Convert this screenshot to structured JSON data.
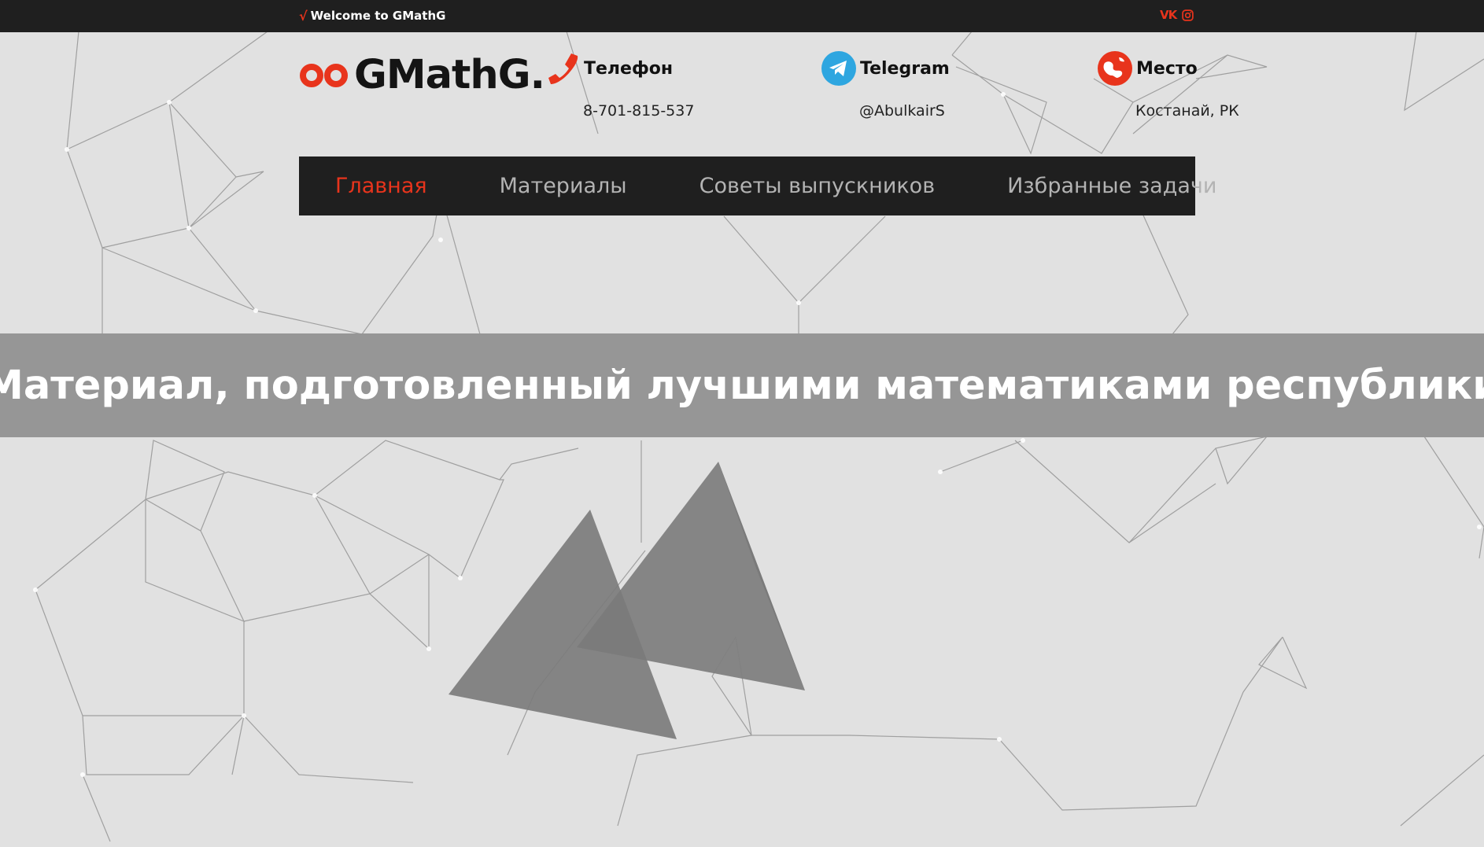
{
  "topbar": {
    "welcome_text": "Welcome to GMathG",
    "welcome_icon": "sqrt-icon",
    "social": [
      {
        "name": "vk",
        "label": "VK"
      },
      {
        "name": "instagram",
        "label": ""
      }
    ]
  },
  "header": {
    "logo_text": "GMathG.",
    "contacts": [
      {
        "title": "Телефон",
        "value": "8-701-815-537",
        "icon": "phone-icon"
      },
      {
        "title": "Telegram",
        "value": "@AbulkairS",
        "icon": "telegram-icon"
      },
      {
        "title": "Место",
        "value": "Костанай, РК",
        "icon": "globe-icon"
      }
    ]
  },
  "nav": {
    "items": [
      {
        "label": "Главная"
      },
      {
        "label": "Материалы"
      },
      {
        "label": "Советы выпускников"
      },
      {
        "label": "Избранные задачи"
      }
    ]
  },
  "banner": {
    "text": "Материал, подготовленный лучшими математиками республики"
  },
  "colors": {
    "accent": "#e8341c",
    "dark": "#1f1f1f",
    "banner_bg": "#969696",
    "page_bg": "#e1e1e1",
    "telegram": "#2ea6e0"
  }
}
